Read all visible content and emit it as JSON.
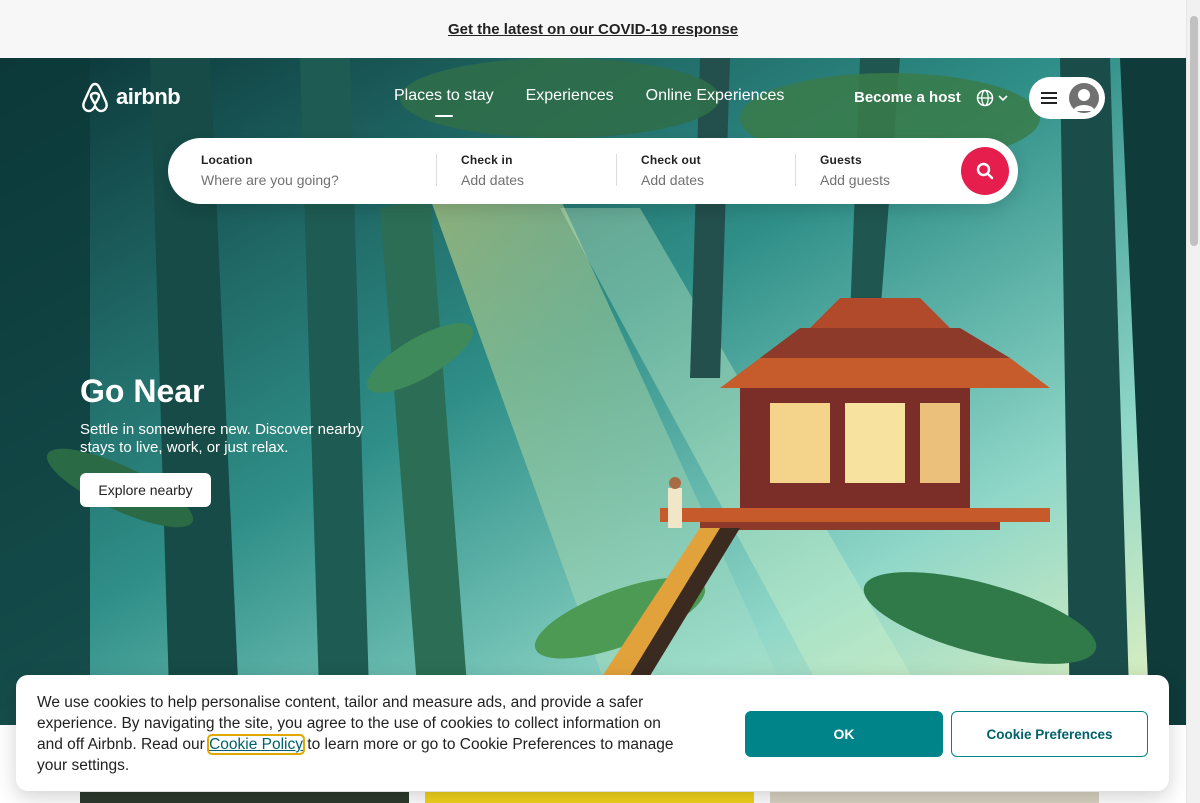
{
  "banner": {
    "link": "Get the latest on our COVID-19 response"
  },
  "header": {
    "logo_text": "airbnb",
    "nav": [
      "Places to stay",
      "Experiences",
      "Online Experiences"
    ],
    "active_nav": "Places to stay",
    "host_link": "Become a host",
    "icons": {
      "language": "globe-icon",
      "menu": "hamburger-icon",
      "avatar": "user-avatar-icon",
      "search": "search-icon"
    }
  },
  "search": {
    "location": {
      "label": "Location",
      "placeholder": "Where are you going?"
    },
    "check_in": {
      "label": "Check in",
      "value": "Add dates"
    },
    "check_out": {
      "label": "Check out",
      "value": "Add dates"
    },
    "guests": {
      "label": "Guests",
      "value": "Add guests"
    }
  },
  "hero": {
    "title": "Go Near",
    "subtitle": "Settle in somewhere new. Discover nearby stays to live, work, or just relax.",
    "button": "Explore nearby"
  },
  "cookie": {
    "text_before": "We use cookies to help personalise content, tailor and measure ads, and provide a safer experience. By navigating the site, you agree to the use of cookies to collect information on and off Airbnb. Read our ",
    "policy_link": "Cookie Policy",
    "text_after": " to learn more or go to Cookie Preferences to manage your settings.",
    "ok": "OK",
    "preferences": "Cookie Preferences"
  },
  "colors": {
    "brand": "#ff385c",
    "search_button": "#e61e4d",
    "teal": "#008489"
  }
}
